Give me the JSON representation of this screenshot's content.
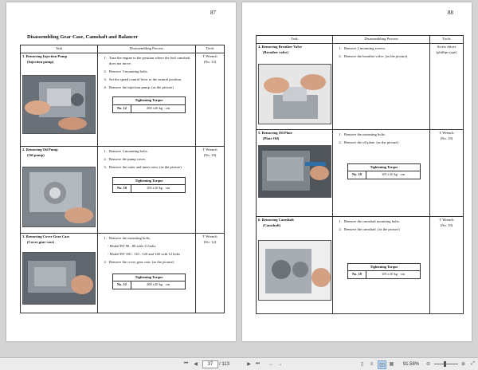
{
  "left_page": {
    "page_number": "87",
    "title": "Disassembling Gear Case, Camshaft and Balancer",
    "headers": [
      "Task",
      "Disassembling Process",
      "Tools"
    ],
    "rows": [
      {
        "task": "1. Removing Injection Pump",
        "task_sub": "(Injection pump)",
        "steps": [
          "Turn the engine to the position where the fuel camshaft does not move.",
          "Remove 3 mounting bolts.",
          "Set the speed control lever to the neutral position.",
          "Remove the injection pump. (as the picture)"
        ],
        "notes": [],
        "steps_after": [],
        "torque_title": "Tightening Torque",
        "torque_no": "No. 12",
        "torque_value": "200 ±20 kg · cm",
        "tool": "T Wrench",
        "tool_no": "(No. 12)"
      },
      {
        "task": "2. Removing Oil Pump",
        "task_sub": "(Oil pump)",
        "steps": [
          "Remove 3 mounting bolts.",
          "Remove the pump cover.",
          "Remove the outer and inner rotor. (as the picture)"
        ],
        "notes": [],
        "steps_after": [],
        "torque_title": "Tightening Torque",
        "torque_no": "No. 10",
        "torque_value": "105 ±10 kg · cm",
        "tool": "T Wrench",
        "tool_no": "(No. 10)"
      },
      {
        "task": "3. Removing Cover Gear Case",
        "task_sub": "(Cover gear case)",
        "steps": [
          "Remove the mounting bolts."
        ],
        "notes": [
          "- Model BT 90 , 80  with 11 bolts",
          "- Model BT 100 , 110 , 120 and 140  with 12 bolts"
        ],
        "steps_after": [
          "Remove the cover gear case. (as the picture)"
        ],
        "torque_title": "Tightening Torque",
        "torque_no": "No. 12",
        "torque_value": "200 ±20 kg · cm",
        "tool": "T Wrench",
        "tool_no": "(No. 12)"
      }
    ]
  },
  "right_page": {
    "page_number": "88",
    "headers": [
      "Task",
      "Disassembling Process",
      "Tools"
    ],
    "rows": [
      {
        "task": "4. Removing Breather Valve",
        "task_sub": "(Breather valve)",
        "steps": [
          "Remove 2 mounting screws.",
          "Remove the breather valve. (as the picture)"
        ],
        "tool": "Screw driver",
        "tool_no": "(phillips type)"
      },
      {
        "task": "5. Removing Oil Plate",
        "task_sub": "(Plate Oil)",
        "steps": [
          "Remove the mounting bolts.",
          "Remove the oil plate. (as the picture)"
        ],
        "torque_title": "Tightening Torque",
        "torque_no": "No. 10",
        "torque_value": "105 ±10 kg · cm",
        "tool": "T Wrench",
        "tool_no": "(No. 10)"
      },
      {
        "task": "6. Removing Camshaft",
        "task_sub": "(Camshaft)",
        "steps": [
          "Remove the camshaft mounting bolts.",
          "Remove the camshaft. (as the picture)"
        ],
        "torque_title": "Tightening Torque",
        "torque_no": "No. 10",
        "torque_value": "105 ±10 kg · cm",
        "tool": "T Wrench",
        "tool_no": "(No. 10)"
      }
    ]
  },
  "toolbar": {
    "current_page": "37",
    "total_pages": "/ 113",
    "zoom": "91.58%",
    "icons": {
      "first": "first-page-icon",
      "prev": "previous-page-icon",
      "next": "next-page-icon",
      "last": "last-page-icon",
      "back": "back-icon",
      "forward": "forward-icon",
      "single": "single-page-icon",
      "continuous": "continuous-page-icon",
      "facing": "facing-pages-icon",
      "facing_continuous": "facing-continuous-icon",
      "zoom_out": "zoom-out-icon",
      "zoom_in": "zoom-in-icon",
      "fit": "fit-page-icon"
    }
  }
}
